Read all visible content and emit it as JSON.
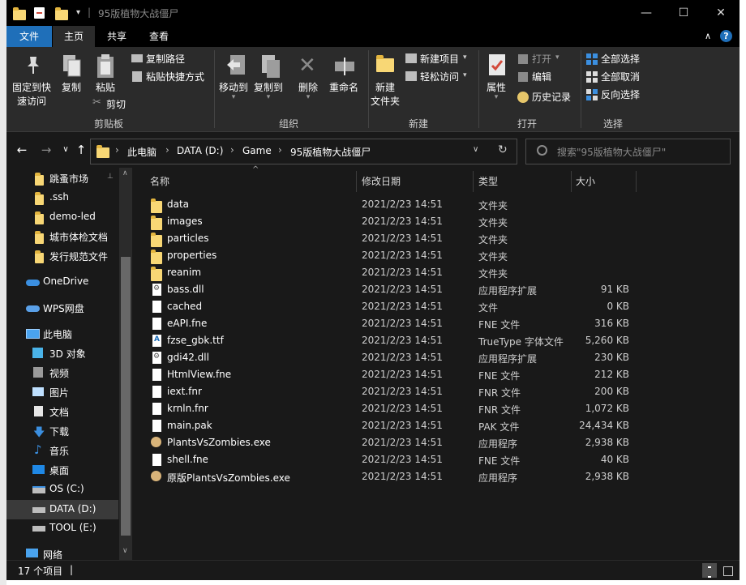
{
  "window": {
    "title": "95版植物大战僵尸",
    "min_glyph": "—",
    "max_glyph": "☐",
    "close_glyph": "✕"
  },
  "menu": {
    "file": "文件",
    "home": "主页",
    "share": "共享",
    "view": "查看",
    "collapse_glyph": "∧",
    "help_glyph": "?"
  },
  "ribbon": {
    "clipboard": {
      "pin_label_1": "固定到快",
      "pin_label_2": "速访问",
      "copy": "复制",
      "paste": "粘贴",
      "copy_path": "复制路径",
      "paste_shortcut": "粘贴快捷方式",
      "cut": "剪切",
      "group": "剪贴板"
    },
    "organize": {
      "move_to": "移动到",
      "copy_to": "复制到",
      "delete": "删除",
      "rename": "重命名",
      "group": "组织"
    },
    "new": {
      "new_folder_1": "新建",
      "new_folder_2": "文件夹",
      "new_item": "新建项目",
      "easy_access": "轻松访问",
      "group": "新建"
    },
    "open": {
      "properties": "属性",
      "open": "打开",
      "edit": "编辑",
      "history": "历史记录",
      "group": "打开"
    },
    "select": {
      "select_all": "全部选择",
      "select_none": "全部取消",
      "invert": "反向选择",
      "group": "选择"
    }
  },
  "address": {
    "back": "←",
    "forward": "→",
    "recent": "∨",
    "up": "↑",
    "crumbs": [
      "此电脑",
      "DATA (D:)",
      "Game",
      "95版植物大战僵尸"
    ],
    "crumb_sep": "›",
    "dropdown": "∨",
    "refresh": "↻",
    "search_placeholder": "搜索\"95版植物大战僵尸\""
  },
  "nav": {
    "items": [
      {
        "label": "跳蚤市场"
      },
      {
        "label": ".ssh"
      },
      {
        "label": "demo-led"
      },
      {
        "label": "城市体检文档"
      },
      {
        "label": "发行规范文件"
      },
      {
        "label": "OneDrive"
      },
      {
        "label": "WPS网盘"
      },
      {
        "label": "此电脑"
      },
      {
        "label": "3D 对象"
      },
      {
        "label": "视频"
      },
      {
        "label": "图片"
      },
      {
        "label": "文档"
      },
      {
        "label": "下载"
      },
      {
        "label": "音乐"
      },
      {
        "label": "桌面"
      },
      {
        "label": "OS (C:)"
      },
      {
        "label": "DATA (D:)"
      },
      {
        "label": "TOOL (E:)"
      },
      {
        "label": "网络"
      }
    ],
    "pin_glyph": "📌"
  },
  "columns": {
    "name": "名称",
    "date": "修改日期",
    "type": "类型",
    "size": "大小",
    "sort_glyph": "^"
  },
  "files": [
    {
      "name": "data",
      "date": "2021/2/23 14:51",
      "type": "文件夹",
      "size": "",
      "kind": "folder"
    },
    {
      "name": "images",
      "date": "2021/2/23 14:51",
      "type": "文件夹",
      "size": "",
      "kind": "folder"
    },
    {
      "name": "particles",
      "date": "2021/2/23 14:51",
      "type": "文件夹",
      "size": "",
      "kind": "folder"
    },
    {
      "name": "properties",
      "date": "2021/2/23 14:51",
      "type": "文件夹",
      "size": "",
      "kind": "folder"
    },
    {
      "name": "reanim",
      "date": "2021/2/23 14:51",
      "type": "文件夹",
      "size": "",
      "kind": "folder"
    },
    {
      "name": "bass.dll",
      "date": "2021/2/23 14:51",
      "type": "应用程序扩展",
      "size": "91 KB",
      "kind": "dll"
    },
    {
      "name": "cached",
      "date": "2021/2/23 14:51",
      "type": "文件",
      "size": "0 KB",
      "kind": "file"
    },
    {
      "name": "eAPI.fne",
      "date": "2021/2/23 14:51",
      "type": "FNE 文件",
      "size": "316 KB",
      "kind": "file"
    },
    {
      "name": "fzse_gbk.ttf",
      "date": "2021/2/23 14:51",
      "type": "TrueType 字体文件",
      "size": "5,260 KB",
      "kind": "ttf"
    },
    {
      "name": "gdi42.dll",
      "date": "2021/2/23 14:51",
      "type": "应用程序扩展",
      "size": "230 KB",
      "kind": "dll"
    },
    {
      "name": "HtmlView.fne",
      "date": "2021/2/23 14:51",
      "type": "FNE 文件",
      "size": "212 KB",
      "kind": "file"
    },
    {
      "name": "iext.fnr",
      "date": "2021/2/23 14:51",
      "type": "FNR 文件",
      "size": "200 KB",
      "kind": "file"
    },
    {
      "name": "krnln.fnr",
      "date": "2021/2/23 14:51",
      "type": "FNR 文件",
      "size": "1,072 KB",
      "kind": "file"
    },
    {
      "name": "main.pak",
      "date": "2021/2/23 14:51",
      "type": "PAK 文件",
      "size": "24,434 KB",
      "kind": "file"
    },
    {
      "name": "PlantsVsZombies.exe",
      "date": "2021/2/23 14:51",
      "type": "应用程序",
      "size": "2,938 KB",
      "kind": "exe"
    },
    {
      "name": "shell.fne",
      "date": "2021/2/23 14:51",
      "type": "FNE 文件",
      "size": "40 KB",
      "kind": "file"
    },
    {
      "name": "原版PlantsVsZombies.exe",
      "date": "2021/2/23 14:51",
      "type": "应用程序",
      "size": "2,938 KB",
      "kind": "exe"
    }
  ],
  "status": {
    "count": "17 个项目",
    "sep": "|"
  },
  "colors": {
    "accent": "#1f6fb9",
    "folder": "#f8d775",
    "background": "#191919",
    "ribbon": "#2b2b2b"
  }
}
